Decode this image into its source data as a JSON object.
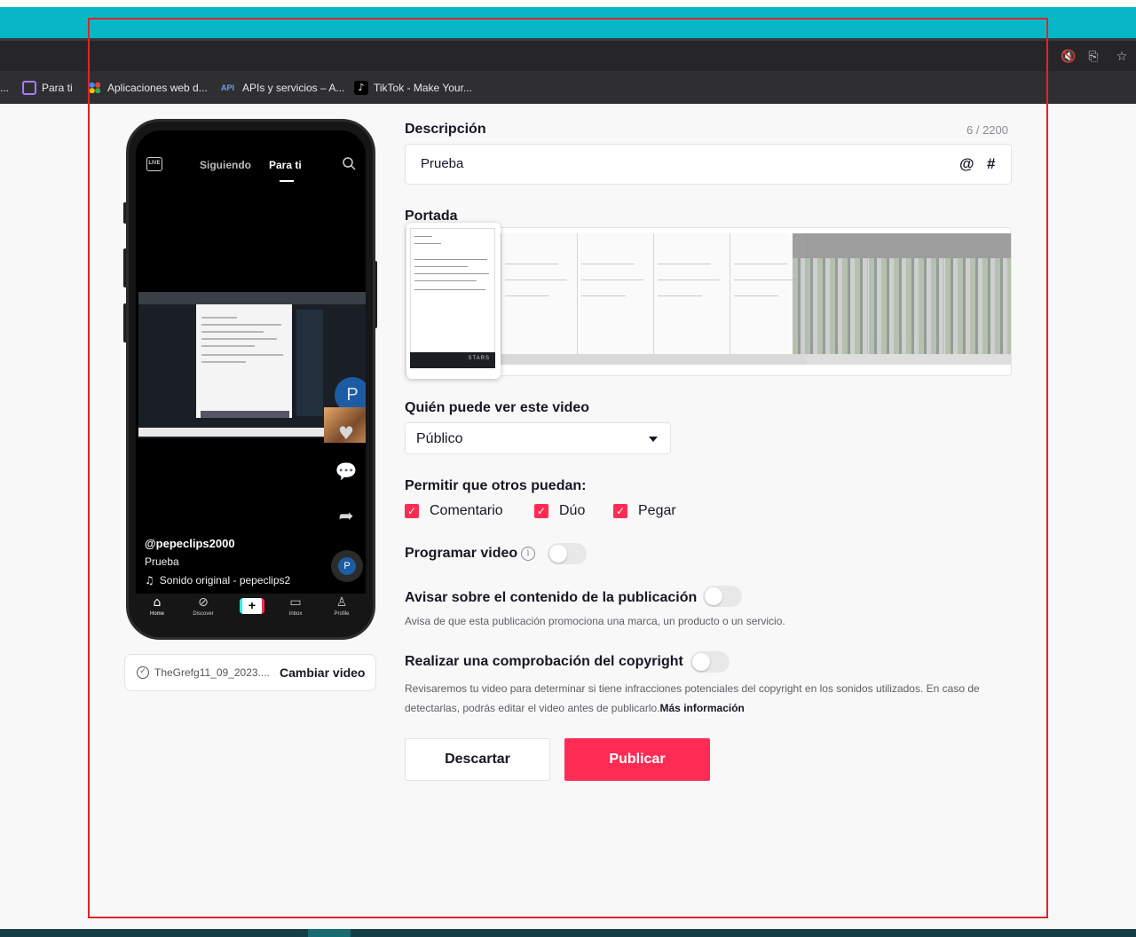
{
  "browser": {
    "bookmarks": [
      {
        "label": "Para ti",
        "icon": "message-bubble-icon",
        "color": "#8a5cf6"
      },
      {
        "label": "Aplicaciones web d...",
        "icon": "google-apps-icon",
        "color": "#f4b400"
      },
      {
        "label": "APIs y servicios – A...",
        "icon": "api-icon",
        "color": "#4c8bf5"
      },
      {
        "label": "TikTok - Make Your...",
        "icon": "tiktok-icon",
        "color": "#000000"
      }
    ],
    "leading_ellipsis": "..."
  },
  "phone": {
    "tab_following": "Siguiendo",
    "tab_for_you": "Para ti",
    "live_label": "LIVE",
    "avatar_letter": "P",
    "username": "@pepeclips2000",
    "caption": "Prueba",
    "sound": "Sonido original - pepeclips2",
    "tabbar": [
      {
        "label": "Home",
        "icon": "home-icon"
      },
      {
        "label": "Discover",
        "icon": "compass-icon"
      },
      {
        "label": "",
        "icon": "plus-icon"
      },
      {
        "label": "Inbox",
        "icon": "inbox-icon"
      },
      {
        "label": "Profile",
        "icon": "profile-icon"
      }
    ],
    "plus": "+"
  },
  "file": {
    "name": "TheGrefg11_09_2023....",
    "change_label": "Cambiar video"
  },
  "form": {
    "description_label": "Descripción",
    "description_counter": "6 / 2200",
    "description_value": "Prueba",
    "mention_symbol": "@",
    "hashtag_symbol": "#",
    "cover_label": "Portada",
    "cover_frame_text": "STARS",
    "visibility_label": "Quién puede ver este video",
    "visibility_value": "Público",
    "allow_label": "Permitir que otros puedan:",
    "allow_options": [
      {
        "label": "Comentario",
        "checked": true
      },
      {
        "label": "Dúo",
        "checked": true
      },
      {
        "label": "Pegar",
        "checked": true
      }
    ],
    "schedule_label": "Programar video",
    "schedule_on": false,
    "disclose_label": "Avisar sobre el contenido de la publicación",
    "disclose_on": false,
    "disclose_help": "Avisa de que esta publicación promociona una marca, un producto o un servicio.",
    "copyright_label": "Realizar una comprobación del copyright",
    "copyright_on": false,
    "copyright_help_1": "Revisaremos tu video para determinar si tiene infracciones potenciales del copyright en los sonidos utilizados. En caso de",
    "copyright_help_2": "detectarlas, podrás editar el video antes de publicarlo.",
    "copyright_more": "Más información",
    "discard_label": "Descartar",
    "publish_label": "Publicar"
  },
  "colors": {
    "accent": "#fe2c55",
    "browser_teal": "#07b7c6",
    "selection_outline": "#e0242a"
  }
}
